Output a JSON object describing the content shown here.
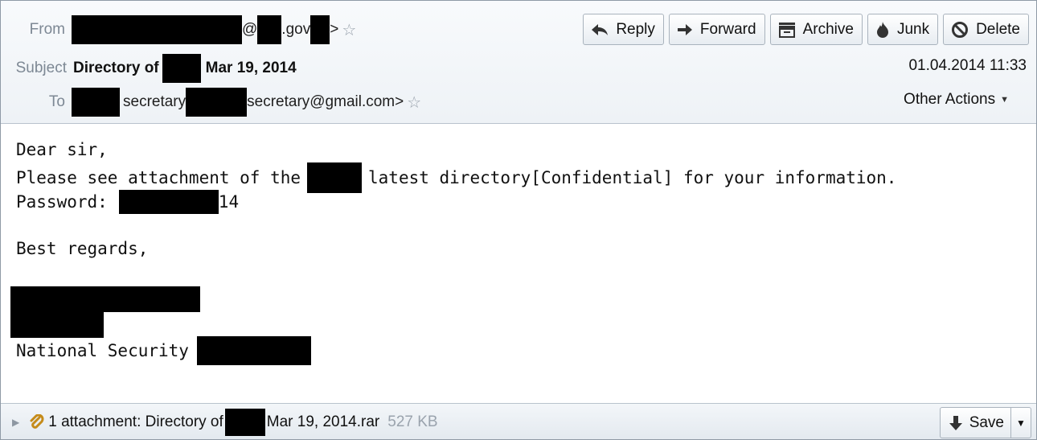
{
  "header": {
    "from_label": "From",
    "from_at": "@",
    "from_domain": ".gov",
    "from_end": ">",
    "subject_label": "Subject",
    "subject_prefix": "Directory of",
    "subject_suffix": "Mar 19, 2014",
    "date": "01.04.2014 11:33",
    "to_label": "To",
    "to_name": "secretary",
    "to_email": "secretary@gmail.com>",
    "other_actions": "Other Actions"
  },
  "toolbar": {
    "reply": "Reply",
    "forward": "Forward",
    "archive": "Archive",
    "junk": "Junk",
    "delete": "Delete"
  },
  "body": {
    "greeting": "Dear sir,",
    "line2_start": "Please see attachment of the",
    "line2_end": "latest directory[Confidential] for your information.",
    "password_label": "Password:",
    "password_end": "14",
    "regards": "Best regards,",
    "signature_prefix": "National Security"
  },
  "attachment": {
    "label_start": "1 attachment: Directory of",
    "label_end": "Mar 19, 2014.rar",
    "size": "527 KB",
    "save": "Save"
  }
}
